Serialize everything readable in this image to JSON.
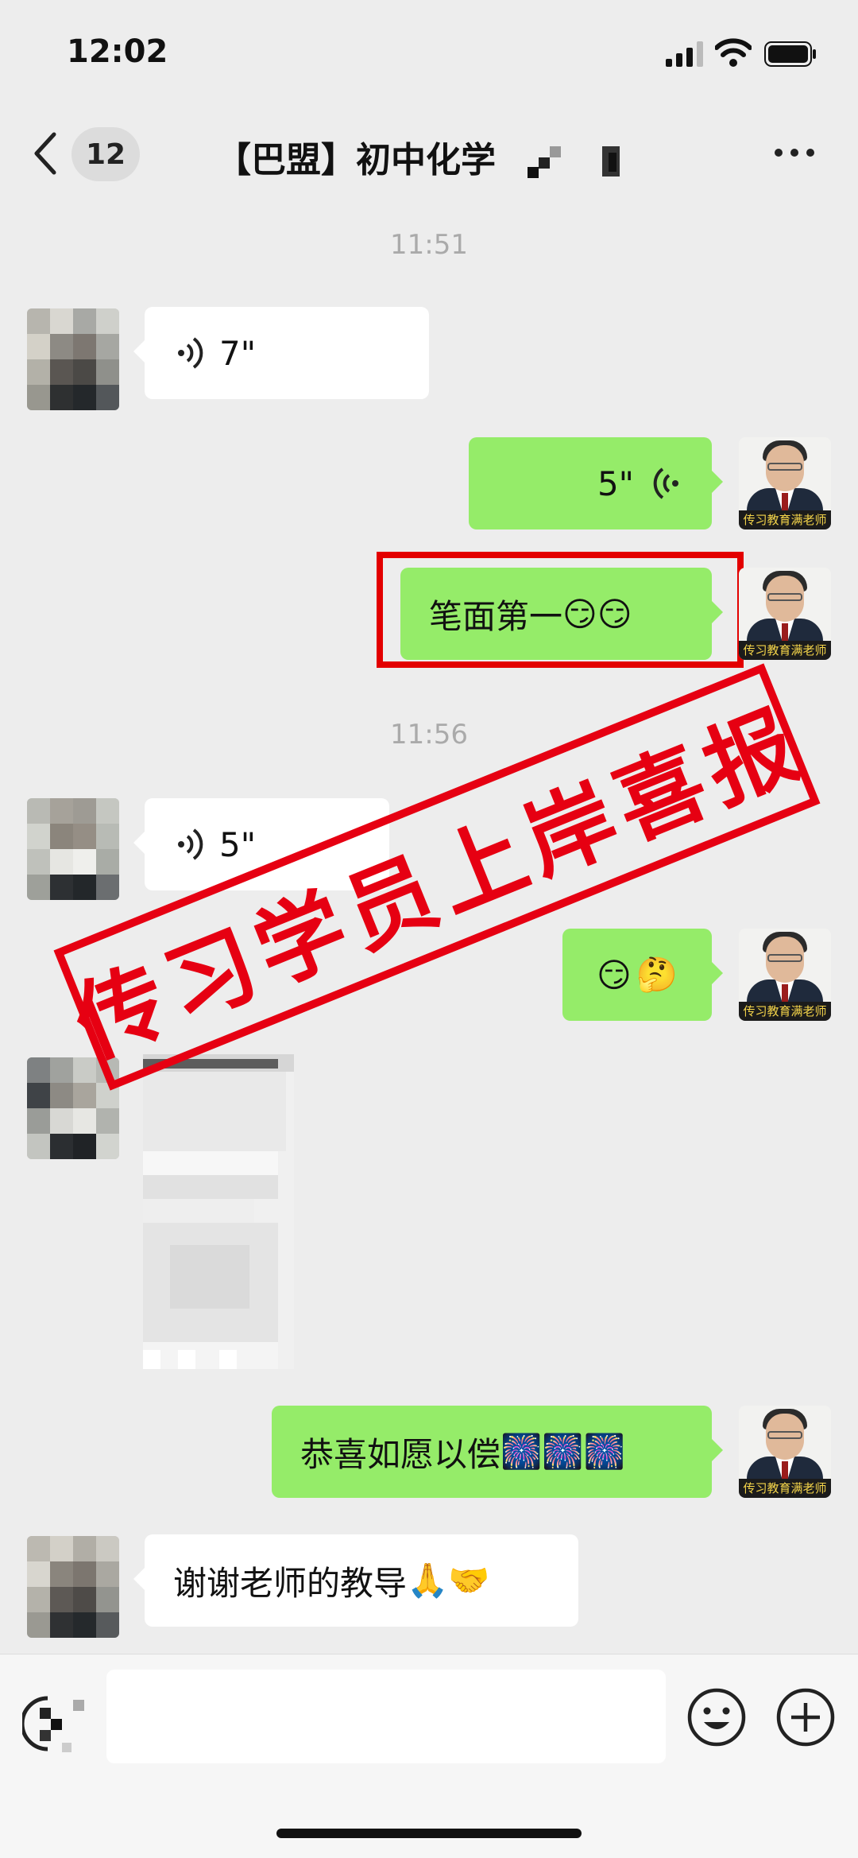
{
  "status": {
    "time": "12:02"
  },
  "header": {
    "back_count": "12",
    "title": "【巴盟】初中化学"
  },
  "times": [
    "11:51",
    "11:56"
  ],
  "messages": {
    "m1": {
      "duration": "7\""
    },
    "m2": {
      "duration": "5\""
    },
    "m3": {
      "text": "笔面第一"
    },
    "m4": {
      "duration": "5\""
    },
    "m6": {
      "text": "恭喜如愿以偿"
    },
    "m7": {
      "text": "谢谢老师的教导"
    }
  },
  "stamp": {
    "text": "传习学员上岸喜报"
  },
  "teacher_caption": "传习教育满老师",
  "emoji": {
    "smirk": "😏",
    "thinking": "🤔",
    "fireworks": "🎆",
    "pray": "🙏",
    "handshake": "🤝"
  },
  "colors": {
    "sent_bubble": "#95ec69",
    "received_bubble": "#ffffff",
    "stamp_red": "#e60012",
    "background": "#ededed"
  }
}
